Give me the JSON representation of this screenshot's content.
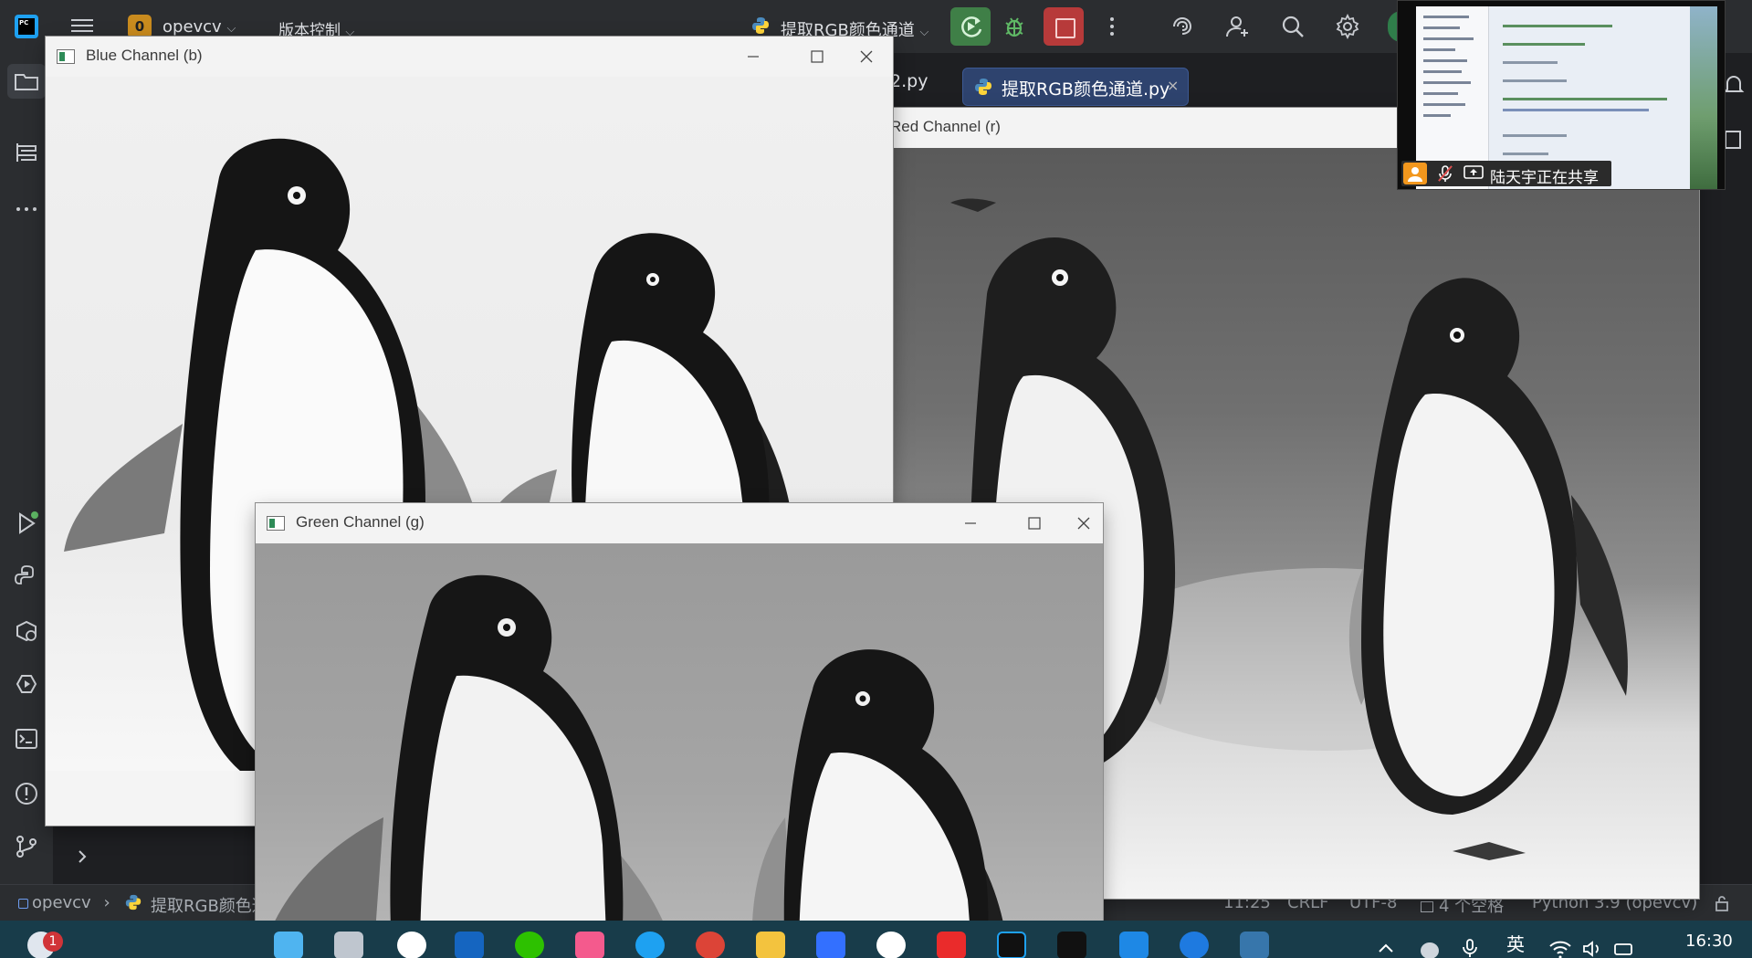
{
  "ide": {
    "project_badge": "0",
    "project_name": "opevcv",
    "vcs_label": "版本控制",
    "run_config": "提取RGB颜色通道",
    "tab_partial": "2.py",
    "tab_active": "提取RGB颜色通道.py",
    "tab_close": "×",
    "brand_text": "PC"
  },
  "windows": {
    "blue": {
      "title": "Blue Channel (b)"
    },
    "red": {
      "title": "Red Channel (r)"
    },
    "green": {
      "title": "Green Channel (g)"
    }
  },
  "status_bar": {
    "crumb_project": "opevcv",
    "crumb_file": "提取RGB颜色通",
    "position": "11:25",
    "line_sep": "CRLF",
    "encoding": "UTF-8",
    "indent": "4 个空格",
    "interpreter": "Python 3.9 (opevcv)"
  },
  "meeting": {
    "sharing_text": "陆天宇正在共享"
  },
  "taskbar": {
    "notification_count": "1",
    "ime": "英",
    "clock": "16:30"
  },
  "colors": {
    "ide_bg": "#1e1f22",
    "ide_panel": "#2b2d30",
    "run_green": "#3f7f47",
    "stop_red": "#b73a3a",
    "active_tab": "#2e436e",
    "taskbar": "#183c4a"
  }
}
